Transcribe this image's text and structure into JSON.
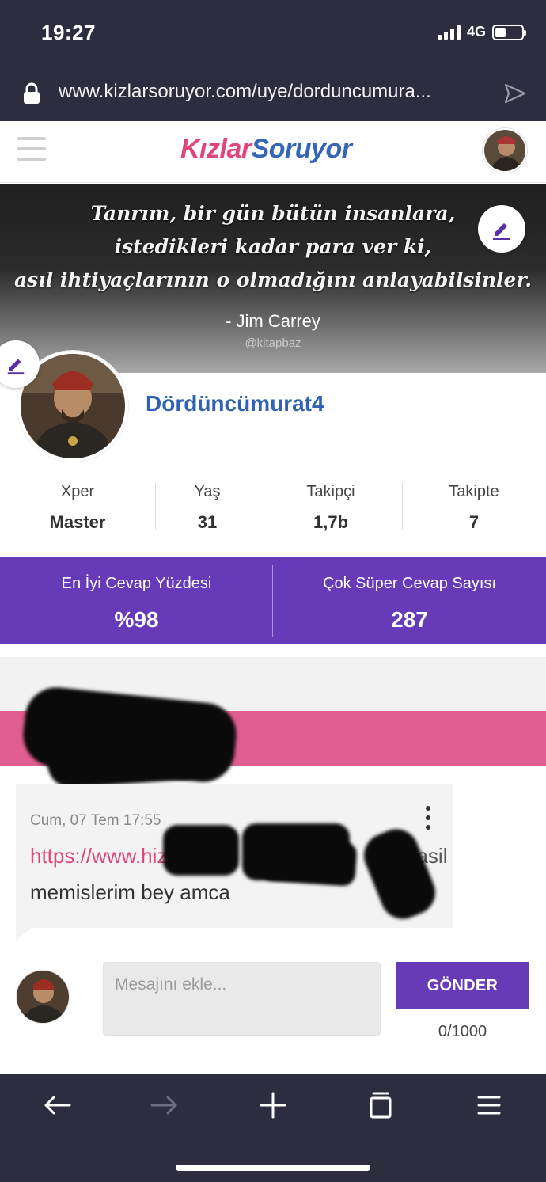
{
  "status_bar": {
    "time": "19:27",
    "network": "4G"
  },
  "browser": {
    "url": "www.kizlarsoruyor.com/uye/dorduncumura..."
  },
  "site": {
    "logo_part1": "Kızlar",
    "logo_part2": "Soruyor"
  },
  "cover": {
    "quote_line1": "Tanrım, bir gün bütün insanlara,",
    "quote_line2": "istedikleri kadar para ver ki,",
    "quote_line3": "asıl ihtiyaçlarının o olmadığını anlayabilsinler.",
    "author": "- Jim Carrey",
    "handle": "@kitapbaz"
  },
  "profile": {
    "username": "Dördüncümurat4",
    "stats": [
      {
        "label": "Xper",
        "value": "Master"
      },
      {
        "label": "Yaş",
        "value": "31"
      },
      {
        "label": "Takipçi",
        "value": "1,7b"
      },
      {
        "label": "Takipte",
        "value": "7"
      }
    ],
    "highlights": [
      {
        "label": "En İyi Cevap Yüzdesi",
        "value": "%98"
      },
      {
        "label": "Çok Süper Cevap Sayısı",
        "value": "287"
      }
    ]
  },
  "message": {
    "time": "Cum, 07 Tem 17:55",
    "link_text": "https://www.hizli",
    "link_suffix": "nasil",
    "text": "memislerim bey amca"
  },
  "composer": {
    "placeholder": "Mesajını ekle...",
    "send_label": "GÖNDER",
    "char_count": "0/1000"
  },
  "colors": {
    "chrome": "#2e2d3f",
    "brand_pink": "#e0457b",
    "brand_blue": "#3667b6",
    "purple": "#673ab7",
    "pink_bar": "#e05e90"
  }
}
